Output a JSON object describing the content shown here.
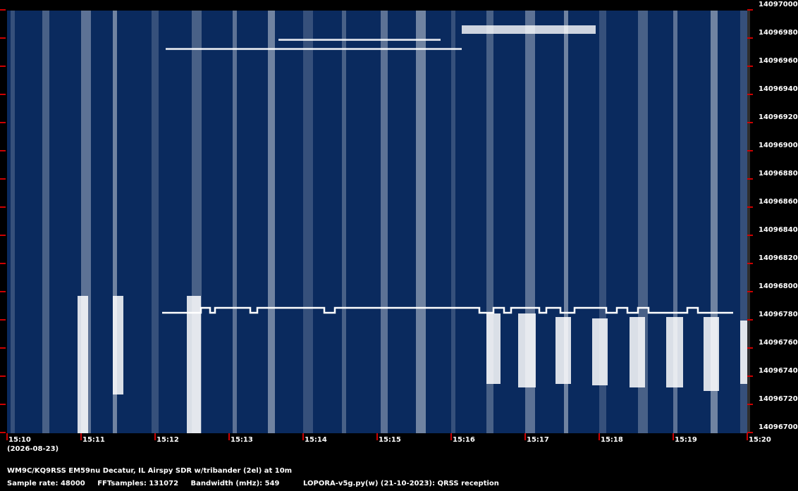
{
  "spectrogram": {
    "colors": {
      "background": "#0a2a5e",
      "signal": "#ffffff",
      "tick": "#cc0000"
    },
    "freq_axis": {
      "labels": [
        "14097000",
        "14096980",
        "14096960",
        "14096940",
        "14096920",
        "14096900",
        "14096880",
        "14096860",
        "14096840",
        "14096820",
        "14096800",
        "14096780",
        "14096760",
        "14096740",
        "14096720",
        "14096700"
      ]
    },
    "time_axis": {
      "labels": [
        "15:10",
        "15:11",
        "15:12",
        "15:13",
        "15:14",
        "15:15",
        "15:16",
        "15:17",
        "15:18",
        "15:19",
        "15:20"
      ],
      "date": "(2026-08-23)"
    }
  },
  "footer": {
    "station": "WM9C/KQ9RSS EM59nu Decatur, IL  Airspy SDR w/tribander (2el) at 10m",
    "sample_rate": "Sample rate: 48000",
    "fft_samples": "FFTsamples: 131072",
    "bandwidth": "Bandwidth (mHz): 549",
    "software": "LOPORA-v5g.py(w) (21-10-2023): QRSS reception"
  }
}
